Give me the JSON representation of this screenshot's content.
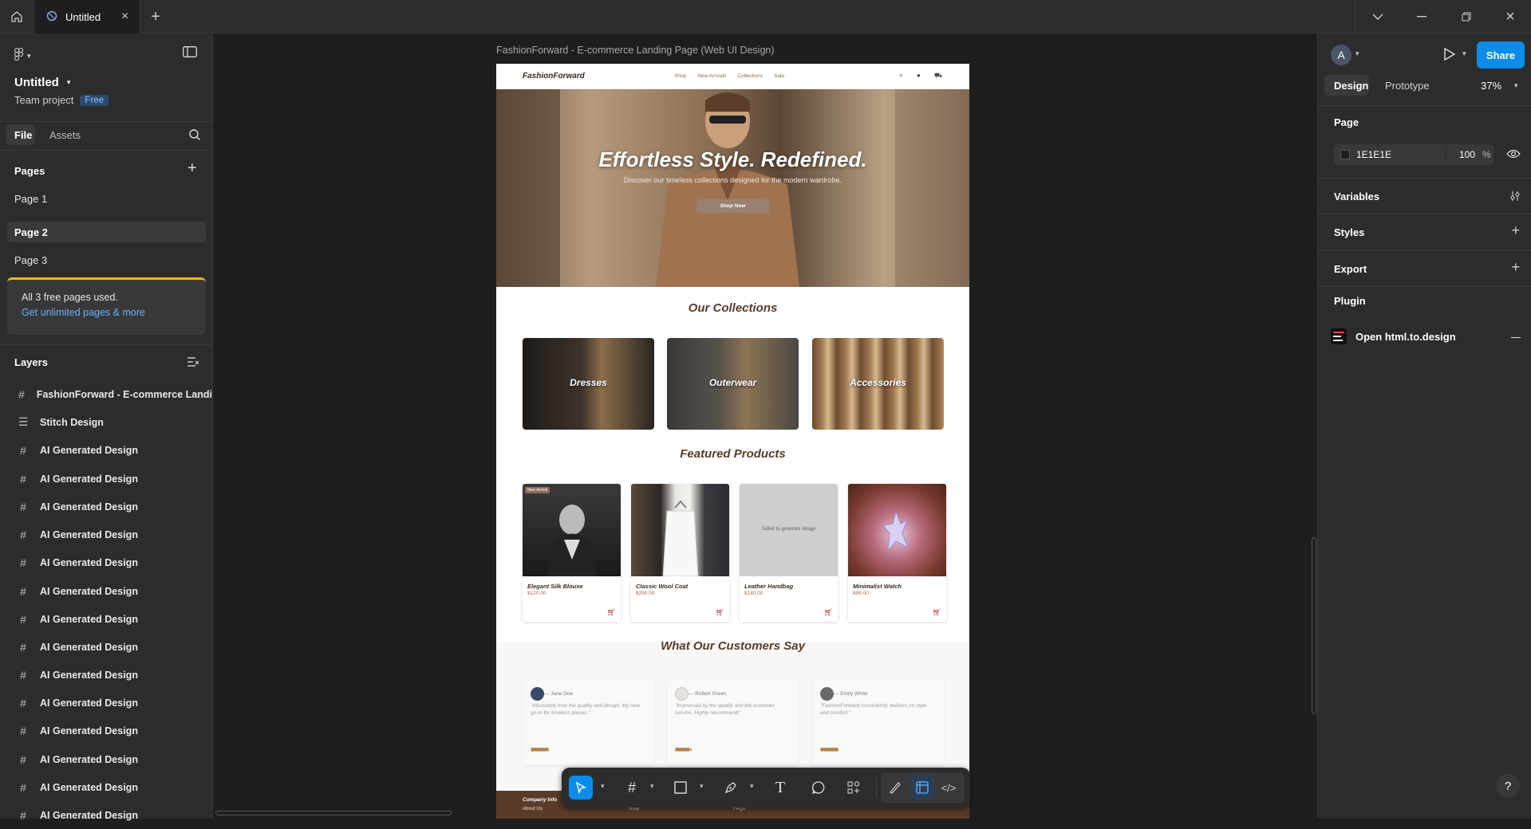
{
  "topbar": {
    "tab_title": "Untitled",
    "icons": [
      "home-icon",
      "figma-file-icon",
      "close-icon",
      "plus-icon",
      "chevron-down-icon",
      "minimize-icon",
      "restore-icon",
      "window-close-icon"
    ]
  },
  "left_panel": {
    "file_name": "Untitled",
    "project": "Team project",
    "plan_badge": "Free",
    "tabs": [
      "File",
      "Assets"
    ],
    "pages_header": "Pages",
    "pages": [
      "Page 1",
      "Page 2",
      "Page 3"
    ],
    "selected_page": "Page 2",
    "notice_text": "All 3 free pages used.",
    "notice_link": "Get unlimited pages & more",
    "layers_header": "Layers",
    "layers": [
      {
        "name": "FashionForward - E-commerce Landi",
        "icon": "frame-icon"
      },
      {
        "name": "Stitch Design",
        "icon": "layout-icon"
      },
      {
        "name": "AI Generated Design",
        "icon": "frame-icon"
      },
      {
        "name": "AI Generated Design",
        "icon": "frame-icon"
      },
      {
        "name": "AI Generated Design",
        "icon": "frame-icon"
      },
      {
        "name": "AI Generated Design",
        "icon": "frame-icon"
      },
      {
        "name": "AI Generated Design",
        "icon": "frame-icon"
      },
      {
        "name": "AI Generated Design",
        "icon": "frame-icon"
      },
      {
        "name": "AI Generated Design",
        "icon": "frame-icon"
      },
      {
        "name": "AI Generated Design",
        "icon": "frame-icon"
      },
      {
        "name": "AI Generated Design",
        "icon": "frame-icon"
      },
      {
        "name": "AI Generated Design",
        "icon": "frame-icon"
      },
      {
        "name": "AI Generated Design",
        "icon": "frame-icon"
      },
      {
        "name": "AI Generated Design",
        "icon": "frame-icon"
      },
      {
        "name": "AI Generated Design",
        "icon": "frame-icon"
      },
      {
        "name": "AI Generated Design",
        "icon": "frame-icon"
      }
    ]
  },
  "canvas": {
    "frame_label": "FashionForward - E-commerce Landing Page (Web UI Design)",
    "site": {
      "brand": "FashionForward",
      "nav": [
        "Shop",
        "New Arrivals",
        "Collections",
        "Sale"
      ],
      "hero_title": "Effortless Style. Redefined.",
      "hero_subtitle": "Discover our timeless collections designed for the modern wardrobe.",
      "hero_cta": "Shop Now",
      "collections_title": "Our Collections",
      "collections": [
        "Dresses",
        "Outerwear",
        "Accessories"
      ],
      "featured_title": "Featured Products",
      "products": [
        {
          "name": "Elegant Silk Blouse",
          "price": "$120.00",
          "badge": "New Arrival"
        },
        {
          "name": "Classic Wool Coat",
          "price": "$250.00"
        },
        {
          "name": "Leather Handbag",
          "price": "$180.00",
          "img_text": "failed to generate image"
        },
        {
          "name": "Minimalist Watch",
          "price": "$95.00"
        }
      ],
      "testimonials_title": "What Our Customers Say",
      "testimonials": [
        {
          "name": "— Jane Doe",
          "quote": "\"Absolutely love the quality and design. My new go-to for timeless pieces.\"",
          "stars": "■■■■■"
        },
        {
          "name": "— Robert Green",
          "quote": "\"Impressed by the quality and the customer service. Highly recommend!\"",
          "stars": "■■■■◐"
        },
        {
          "name": "— Emily White",
          "quote": "\"FashionForward consistently delivers on style and comfort.\"",
          "stars": "■■■■■"
        }
      ],
      "footer": {
        "company_heading": "Company Info",
        "links_col1": [
          "About Us"
        ],
        "links_col2": [
          "Shop"
        ],
        "links_col3": [
          "FAQs"
        ]
      }
    }
  },
  "right_panel": {
    "avatar_letter": "A",
    "share_label": "Share",
    "tabs": [
      "Design",
      "Prototype"
    ],
    "zoom": "37%",
    "page_header": "Page",
    "bg_color": "1E1E1E",
    "bg_opacity": "100",
    "percent": "%",
    "sections": [
      "Variables",
      "Styles",
      "Export",
      "Plugin"
    ],
    "plugin_name": "Open html.to.design"
  },
  "toolbar": {
    "tools": [
      "move-tool-icon",
      "frame-tool-icon",
      "rectangle-tool-icon",
      "pen-tool-icon",
      "text-tool-icon",
      "comment-tool-icon",
      "actions-tool-icon",
      "draw-mode-icon",
      "design-mode-icon",
      "dev-mode-icon"
    ]
  },
  "help_label": "?",
  "colors": {
    "accent": "#0c8ce9",
    "panel": "#2c2c2c",
    "canvas": "#1e1e1e",
    "brand_brown": "#5a3b2a",
    "notice_yellow": "#f2b321"
  }
}
